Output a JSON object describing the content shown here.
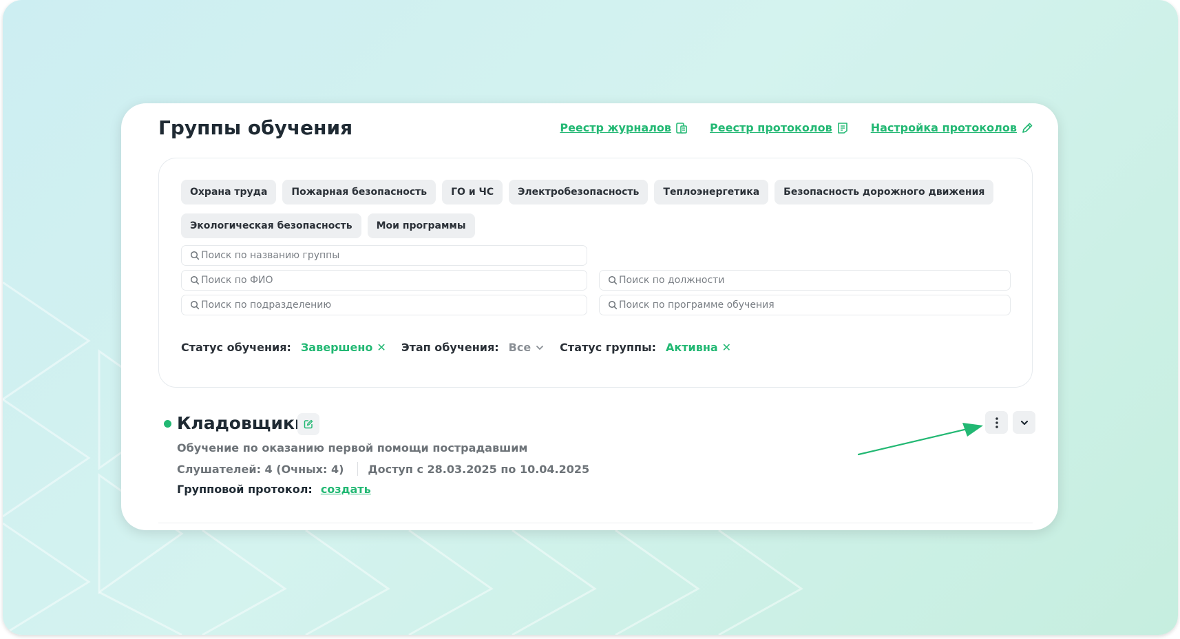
{
  "page_title": "Группы обучения",
  "header_links": [
    {
      "label": "Реестр журналов",
      "icon": "journal-icon"
    },
    {
      "label": "Реестр протоколов",
      "icon": "document-icon"
    },
    {
      "label": "Настройка протоколов",
      "icon": "pencil-icon"
    }
  ],
  "categories": [
    "Охрана труда",
    "Пожарная безопасность",
    "ГО и ЧС",
    "Электробезопасность",
    "Теплоэнергетика",
    "Безопасность дорожного движения",
    "Экологическая безопасность",
    "Мои программы"
  ],
  "search": {
    "group_name_placeholder": "Поиск по названию группы",
    "fio_placeholder": "Поиск по ФИО",
    "position_placeholder": "Поиск по должности",
    "department_placeholder": "Поиск по подразделению",
    "program_placeholder": "Поиск по программе обучения"
  },
  "filters": {
    "training_status_label": "Статус обучения:",
    "training_status_value": "Завершено",
    "stage_label": "Этап обучения:",
    "stage_value": "Все",
    "group_status_label": "Статус группы:",
    "group_status_value": "Активна"
  },
  "group": {
    "name": "Кладовщики",
    "program": "Обучение по оказанию первой помощи пострадавшим",
    "listeners": "Слушателей: 4 (Очных: 4)",
    "access": "Доступ с 28.03.2025 по 10.04.2025",
    "protocol_label": "Групповой протокол:",
    "protocol_action": "создать"
  },
  "colors": {
    "accent": "#22b873",
    "title": "#1f2a33",
    "muted": "#6d7378",
    "chip_bg": "#edeff1"
  }
}
